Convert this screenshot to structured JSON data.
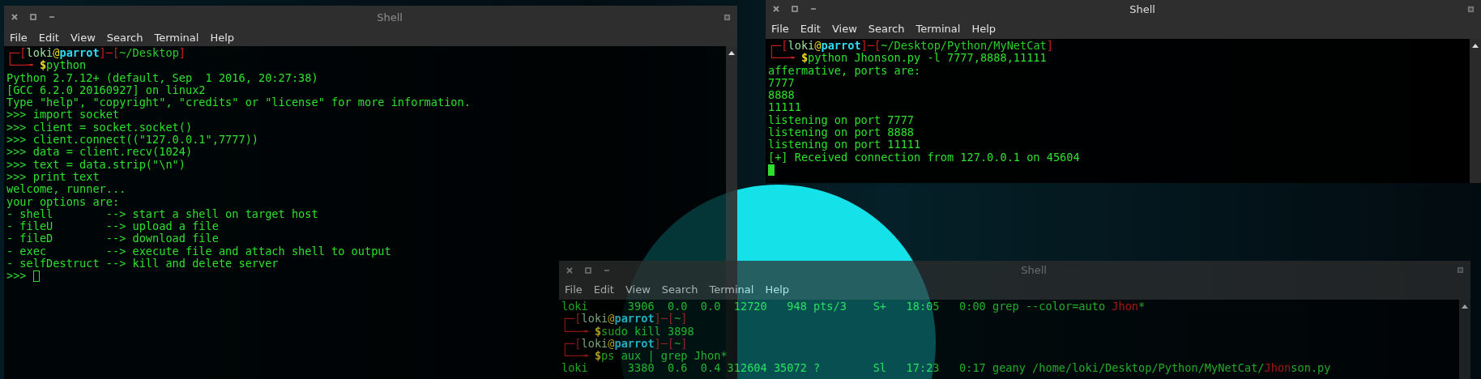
{
  "windows": [
    {
      "title": "Shell",
      "focused": false,
      "dimmed": false,
      "menu": [
        "File",
        "Edit",
        "View",
        "Search",
        "Terminal",
        "Help"
      ],
      "lines": [
        {
          "segments": [
            {
              "kind": "frame",
              "text": "┌─["
            },
            {
              "kind": "user",
              "text": "loki"
            },
            {
              "kind": "at",
              "text": "@"
            },
            {
              "kind": "host",
              "text": "parrot"
            },
            {
              "kind": "frame",
              "text": "]─["
            },
            {
              "kind": "path",
              "text": "~/Desktop"
            },
            {
              "kind": "frame",
              "text": "]"
            }
          ]
        },
        {
          "segments": [
            {
              "kind": "frame",
              "text": "└──╼ "
            },
            {
              "kind": "dollar",
              "text": "$"
            },
            {
              "kind": "out",
              "text": "python"
            }
          ]
        },
        {
          "text": "Python 2.7.12+ (default, Sep  1 2016, 20:27:38)"
        },
        {
          "text": "[GCC 6.2.0 20160927] on linux2"
        },
        {
          "text": "Type \"help\", \"copyright\", \"credits\" or \"license\" for more information."
        },
        {
          "text": ">>> import socket"
        },
        {
          "text": ">>> client = socket.socket()"
        },
        {
          "text": ">>> client.connect((\"127.0.0.1\",7777))"
        },
        {
          "text": ">>> data = client.recv(1024)"
        },
        {
          "text": ">>> text = data.strip(\"\\n\")"
        },
        {
          "text": ">>> print text"
        },
        {
          "text": "welcome, runner..."
        },
        {
          "text": "your options are:"
        },
        {
          "text": "- shell        --> start a shell on target host"
        },
        {
          "text": "- fileU        --> upload a file"
        },
        {
          "text": "- fileD        --> download file"
        },
        {
          "text": "- exec         --> execute file and attach shell to output"
        },
        {
          "text": "- selfDestruct --> kill and delete server"
        },
        {
          "text": ">>> ",
          "cursor": true
        }
      ]
    },
    {
      "title": "Shell",
      "focused": true,
      "dimmed": false,
      "menu": [
        "File",
        "Edit",
        "View",
        "Search",
        "Terminal",
        "Help"
      ],
      "lines": [
        {
          "segments": [
            {
              "kind": "frame",
              "text": "┌─["
            },
            {
              "kind": "user",
              "text": "loki"
            },
            {
              "kind": "at",
              "text": "@"
            },
            {
              "kind": "host",
              "text": "parrot"
            },
            {
              "kind": "frame",
              "text": "]─["
            },
            {
              "kind": "path",
              "text": "~/Desktop/Python/MyNetCat"
            },
            {
              "kind": "frame",
              "text": "]"
            }
          ]
        },
        {
          "segments": [
            {
              "kind": "frame",
              "text": "└──╼ "
            },
            {
              "kind": "dollar",
              "text": "$"
            },
            {
              "kind": "out",
              "text": "python Jhonson.py -l 7777,8888,11111"
            }
          ]
        },
        {
          "text": "affermative, ports are:"
        },
        {
          "text": "7777"
        },
        {
          "text": "8888"
        },
        {
          "text": "11111"
        },
        {
          "text": "listening on port 7777"
        },
        {
          "text": "listening on port 8888"
        },
        {
          "text": "listening on port 11111"
        },
        {
          "text": "[+] Received connection from 127.0.0.1 on 45604"
        },
        {
          "cursor": true
        }
      ]
    },
    {
      "title": "Shell",
      "focused": false,
      "dimmed": true,
      "menu": [
        "File",
        "Edit",
        "View",
        "Search",
        "Terminal",
        "Help"
      ],
      "lines": [
        {
          "segments": [
            {
              "kind": "out",
              "text": "loki      3906  0.0  0.0  12720   948 pts/3    S+   18:05   0:00 grep --color=auto "
            },
            {
              "kind": "match",
              "text": "Jhon"
            },
            {
              "kind": "out",
              "text": "*"
            }
          ]
        },
        {
          "segments": [
            {
              "kind": "frame",
              "text": "┌─["
            },
            {
              "kind": "user",
              "text": "loki"
            },
            {
              "kind": "at",
              "text": "@"
            },
            {
              "kind": "host",
              "text": "parrot"
            },
            {
              "kind": "frame",
              "text": "]─["
            },
            {
              "kind": "path",
              "text": "~"
            },
            {
              "kind": "frame",
              "text": "]"
            }
          ]
        },
        {
          "segments": [
            {
              "kind": "frame",
              "text": "└──╼ "
            },
            {
              "kind": "dollar",
              "text": "$"
            },
            {
              "kind": "out",
              "text": "sudo kill 3898"
            }
          ]
        },
        {
          "segments": [
            {
              "kind": "frame",
              "text": "┌─["
            },
            {
              "kind": "user",
              "text": "loki"
            },
            {
              "kind": "at",
              "text": "@"
            },
            {
              "kind": "host",
              "text": "parrot"
            },
            {
              "kind": "frame",
              "text": "]─["
            },
            {
              "kind": "path",
              "text": "~"
            },
            {
              "kind": "frame",
              "text": "]"
            }
          ]
        },
        {
          "segments": [
            {
              "kind": "frame",
              "text": "└──╼ "
            },
            {
              "kind": "dollar",
              "text": "$"
            },
            {
              "kind": "out",
              "text": "ps aux | grep Jhon*"
            }
          ]
        },
        {
          "segments": [
            {
              "kind": "out",
              "text": "loki      3380  0.6  0.4 312604 35072 ?        Sl   17:23   0:17 geany /home/loki/Desktop/Python/MyNetCat/"
            },
            {
              "kind": "match",
              "text": "Jhon"
            },
            {
              "kind": "out",
              "text": "son.py"
            }
          ]
        }
      ]
    }
  ]
}
